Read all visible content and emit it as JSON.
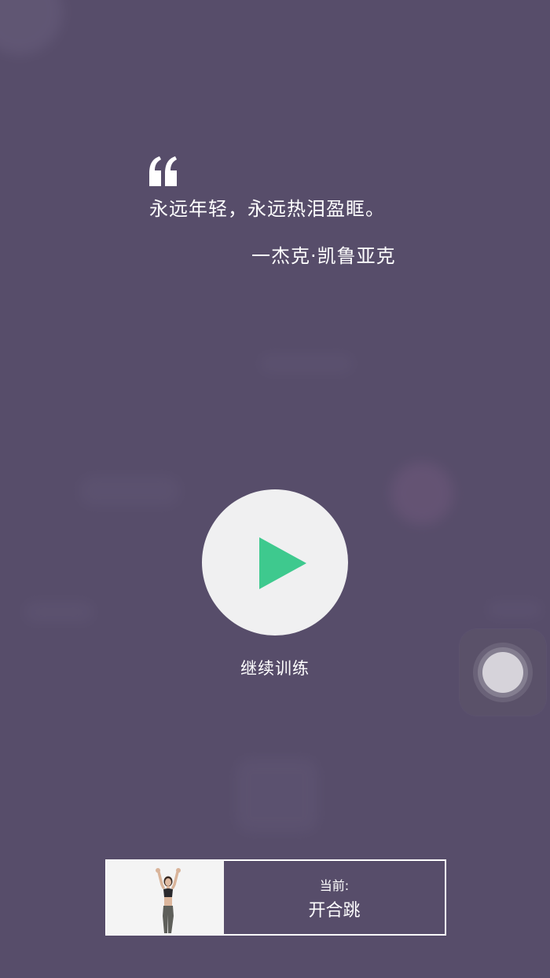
{
  "quote": {
    "text": "永远年轻，永远热泪盈眶。",
    "author": "一杰克·凯鲁亚克",
    "icon": "quote-icon"
  },
  "play": {
    "icon": "play-icon",
    "label": "继续训练"
  },
  "current_exercise": {
    "label": "当前:",
    "name": "开合跳",
    "thumbnail": "exercise-thumbnail"
  },
  "colors": {
    "background": "#574d6a",
    "accent": "#3ec98e",
    "button_bg": "#f0f0f1",
    "text": "#ffffff"
  }
}
